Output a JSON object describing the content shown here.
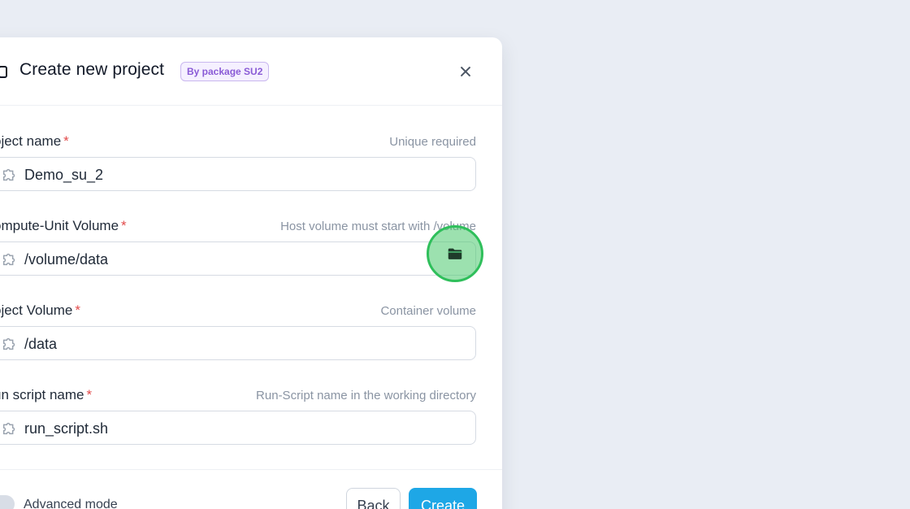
{
  "modal": {
    "title": "Create new project",
    "badge": "By package SU2"
  },
  "fields": [
    {
      "label": "oject name",
      "required": "*",
      "hint": "Unique required",
      "value": "Demo_su_2"
    },
    {
      "label": "ompute-Unit Volume",
      "required": "*",
      "hint": "Host volume must start with /volume",
      "value": "/volume/data"
    },
    {
      "label": "oject Volume",
      "required": "*",
      "hint": "Container volume",
      "value": "/data"
    },
    {
      "label": "un script name",
      "required": "*",
      "hint": "Run-Script name in the working directory",
      "value": "run_script.sh"
    }
  ],
  "footer": {
    "advanced_mode_label": "Advanced mode",
    "back_label": "Back",
    "create_label": "Create"
  },
  "icons": {
    "field_icon": "puzzle-icon",
    "browse_icon": "folder-icon",
    "close_icon": "close-icon",
    "title_icon": "device-icon"
  },
  "colors": {
    "accent": "#1ea7e6",
    "required": "#e24b4b",
    "badge": "#8a5bd6",
    "highlight": "#2fbf5b"
  }
}
